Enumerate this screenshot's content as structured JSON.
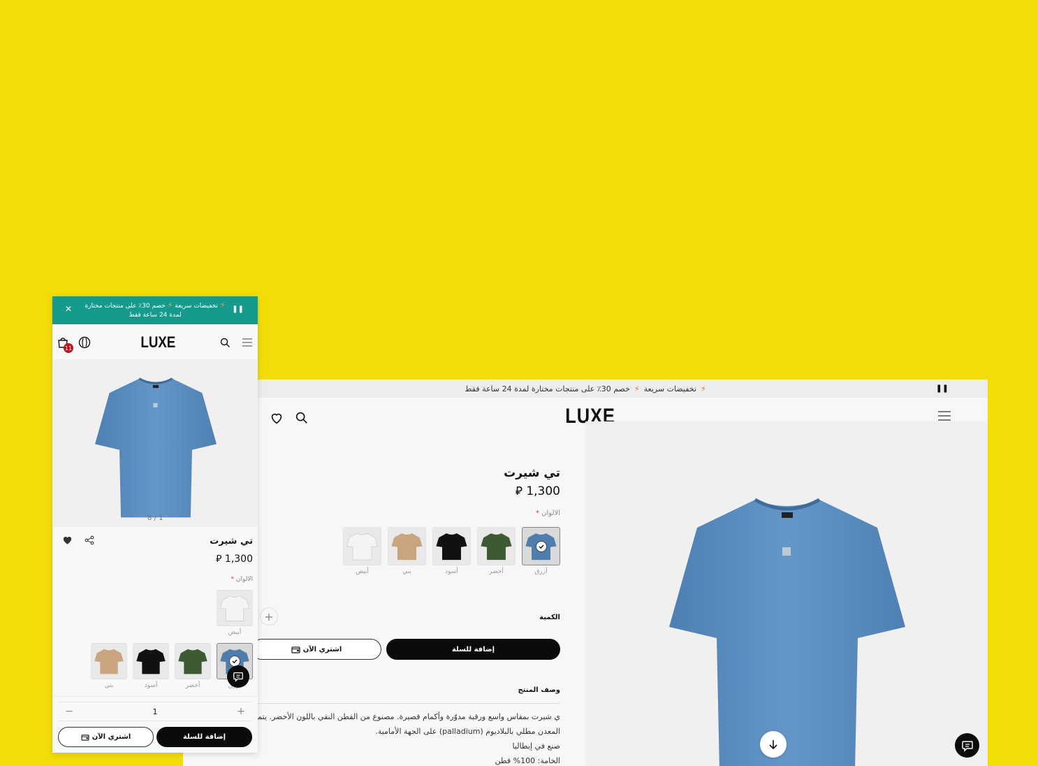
{
  "promo": {
    "flash_label": "تخفيضات سريعة",
    "offer_text": "خصم 30٪ على منتجات مختارة لمدة 24 ساعة فقط",
    "offer_line1": "خصم 30٪ على منتجات مختارة",
    "offer_line2": "لمدة 24 ساعة فقط"
  },
  "brand": {
    "logo": "LUXE"
  },
  "product": {
    "title": "تي شيرت",
    "price": "1,300",
    "currency_symbol": "⃁",
    "colors_label": "الالوان",
    "required_mark": "*",
    "colors": [
      {
        "label": "أزرق",
        "hex": "#4f7ead",
        "selected": true
      },
      {
        "label": "أخضر",
        "hex": "#3d5a35",
        "selected": false
      },
      {
        "label": "أسود",
        "hex": "#111111",
        "selected": false
      },
      {
        "label": "بني",
        "hex": "#c9a47e",
        "selected": false
      },
      {
        "label": "أبيض",
        "hex": "#f4f4f4",
        "selected": false
      }
    ],
    "quantity_label": "الكمية",
    "quantity_value": "1",
    "add_to_cart": "إضافة للسلة",
    "buy_now": "اشتري الآن",
    "description_label": "وصف المنتج",
    "description_lines": [
      "ي شيرت بمقاس واسع ورقبة مدوّرة وأكمام قصيرة. مصنوع من القطن النقي باللون الأخضر. يتميز بشعار F",
      "المعدن مطلي بالبلاديوم (palladium) على الجهة الأمامية.",
      "صنع في إيطاليا",
      "الخامة: 100% قطن"
    ]
  },
  "mobile": {
    "cart_count": "11",
    "pager": "8 / 1"
  },
  "colors": {
    "background": "#f2de06",
    "mobile_promo_bg": "#159a8c",
    "product_blue": "#5b8cbf"
  }
}
